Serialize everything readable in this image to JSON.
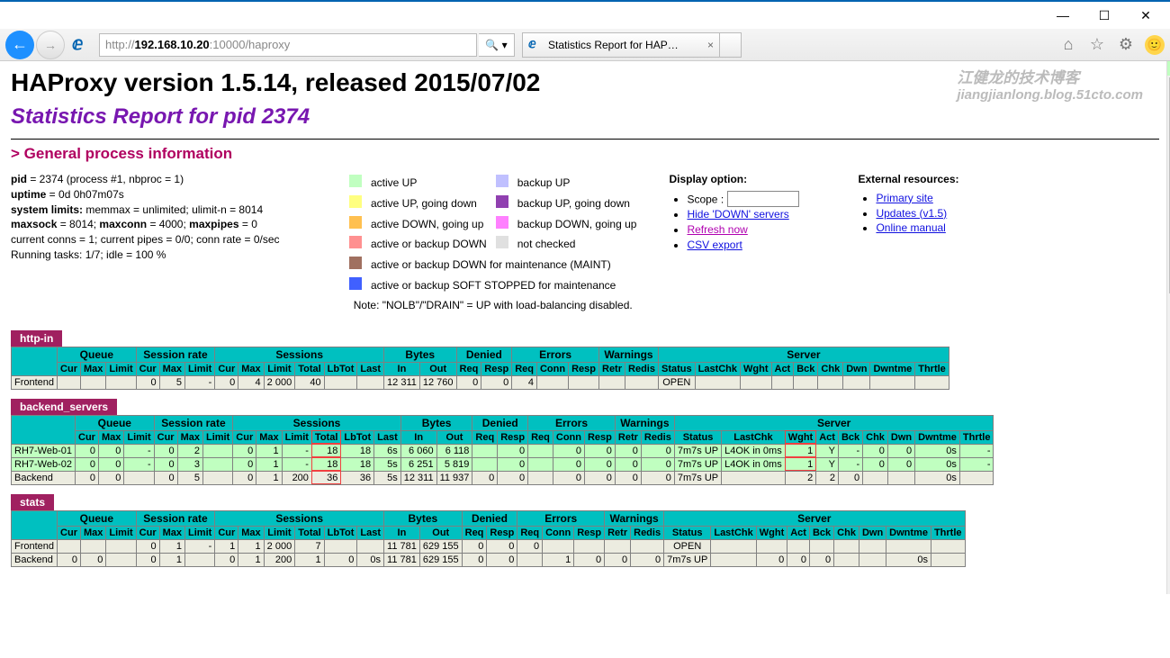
{
  "window": {
    "min": "—",
    "max": "☐",
    "close": "✕"
  },
  "browser": {
    "url_prefix": "http://",
    "url_host": "192.168.10.20",
    "url_port": ":10000",
    "url_path": "/haproxy",
    "tab_title": "Statistics Report for HAP…"
  },
  "watermark": {
    "line1": "江健龙的技术博客",
    "line2": "jiangjianlong.blog.51cto.com"
  },
  "header": {
    "title": "HAProxy version 1.5.14, released 2015/07/02",
    "subtitle": "Statistics Report for pid 2374",
    "section": "> General process information"
  },
  "process": {
    "l1a": "pid",
    "l1b": " = 2374 (process #1, nbproc = 1)",
    "l2a": "uptime",
    "l2b": " = 0d 0h07m07s",
    "l3a": "system limits:",
    "l3b": " memmax = unlimited; ulimit-n = 8014",
    "l4a": "maxsock",
    "l4b": " = 8014; ",
    "l4c": "maxconn",
    "l4d": " = 4000; ",
    "l4e": "maxpipes",
    "l4f": " = 0",
    "l5": "current conns = 1; current pipes = 0/0; conn rate = 0/sec",
    "l6": "Running tasks: 1/7; idle = 100 %"
  },
  "legend": {
    "aup": "active UP",
    "aupgd": "active UP, going down",
    "adgu": "active DOWN, going up",
    "adown": "active or backup DOWN",
    "maint": "active or backup DOWN for maintenance (MAINT)",
    "soft": "active or backup SOFT STOPPED for maintenance",
    "bup": "backup UP",
    "bupgd": "backup UP, going down",
    "bdgu": "backup DOWN, going up",
    "nc": "not checked",
    "note": "Note: \"NOLB\"/\"DRAIN\" = UP with load-balancing disabled."
  },
  "display": {
    "hdr": "Display option:",
    "scope": "Scope :",
    "hide": "Hide 'DOWN' servers",
    "refresh": "Refresh now",
    "csv": "CSV export"
  },
  "ext": {
    "hdr": "External resources:",
    "primary": "Primary site",
    "updates": "Updates (v1.5)",
    "manual": "Online manual"
  },
  "colgroups": {
    "queue": "Queue",
    "srate": "Session rate",
    "sessions": "Sessions",
    "bytes": "Bytes",
    "denied": "Denied",
    "errors": "Errors",
    "warnings": "Warnings",
    "server": "Server"
  },
  "cols": {
    "cur": "Cur",
    "max": "Max",
    "limit": "Limit",
    "total": "Total",
    "lbtot": "LbTot",
    "last": "Last",
    "in": "In",
    "out": "Out",
    "req": "Req",
    "resp": "Resp",
    "conn": "Conn",
    "retr": "Retr",
    "redis": "Redis",
    "status": "Status",
    "lastchk": "LastChk",
    "wght": "Wght",
    "act": "Act",
    "bck": "Bck",
    "chk": "Chk",
    "dwn": "Dwn",
    "dwntme": "Dwntme",
    "thrtle": "Thrtle"
  },
  "tables": {
    "http_in": {
      "name": "http-in",
      "frontend": {
        "name": "Frontend",
        "sr_cur": "0",
        "sr_max": "5",
        "sr_lim": "-",
        "s_cur": "0",
        "s_max": "4",
        "s_lim": "2 000",
        "s_tot": "40",
        "b_in": "12 311",
        "b_out": "12 760",
        "d_req": "0",
        "d_resp": "0",
        "e_req": "4",
        "status": "OPEN"
      }
    },
    "backend_servers": {
      "name": "backend_servers",
      "rows": [
        {
          "name": "RH7-Web-01",
          "q_cur": "0",
          "q_max": "0",
          "q_lim": "-",
          "sr_cur": "0",
          "sr_max": "2",
          "s_cur": "0",
          "s_max": "1",
          "s_lim": "-",
          "s_tot": "18",
          "lbtot": "18",
          "last": "6s",
          "b_in": "6 060",
          "b_out": "6 118",
          "d_req": "",
          "d_resp": "0",
          "e_req": "",
          "e_conn": "0",
          "e_resp": "0",
          "w_retr": "0",
          "w_redis": "0",
          "status": "7m7s UP",
          "lastchk": "L4OK in 0ms",
          "wght": "1",
          "act": "Y",
          "bck": "-",
          "chk": "0",
          "dwn": "0",
          "dwntme": "0s",
          "thrtle": "-"
        },
        {
          "name": "RH7-Web-02",
          "q_cur": "0",
          "q_max": "0",
          "q_lim": "-",
          "sr_cur": "0",
          "sr_max": "3",
          "s_cur": "0",
          "s_max": "1",
          "s_lim": "-",
          "s_tot": "18",
          "lbtot": "18",
          "last": "5s",
          "b_in": "6 251",
          "b_out": "5 819",
          "d_req": "",
          "d_resp": "0",
          "e_req": "",
          "e_conn": "0",
          "e_resp": "0",
          "w_retr": "0",
          "w_redis": "0",
          "status": "7m7s UP",
          "lastchk": "L4OK in 0ms",
          "wght": "1",
          "act": "Y",
          "bck": "-",
          "chk": "0",
          "dwn": "0",
          "dwntme": "0s",
          "thrtle": "-"
        }
      ],
      "backend": {
        "name": "Backend",
        "q_cur": "0",
        "q_max": "0",
        "sr_cur": "0",
        "sr_max": "5",
        "s_cur": "0",
        "s_max": "1",
        "s_lim": "200",
        "s_tot": "36",
        "lbtot": "36",
        "last": "5s",
        "b_in": "12 311",
        "b_out": "11 937",
        "d_req": "0",
        "d_resp": "0",
        "e_req": "",
        "e_conn": "0",
        "e_resp": "0",
        "w_retr": "0",
        "w_redis": "0",
        "status": "7m7s UP",
        "wght": "2",
        "act": "2",
        "bck": "0",
        "dwntme": "0s"
      }
    },
    "stats": {
      "name": "stats",
      "frontend": {
        "name": "Frontend",
        "sr_cur": "0",
        "sr_max": "1",
        "sr_lim": "-",
        "s_cur": "1",
        "s_max": "1",
        "s_lim": "2 000",
        "s_tot": "7",
        "b_in": "11 781",
        "b_out": "629 155",
        "d_req": "0",
        "d_resp": "0",
        "e_req": "0",
        "status": "OPEN"
      },
      "backend": {
        "name": "Backend",
        "q_cur": "0",
        "q_max": "0",
        "sr_cur": "0",
        "sr_max": "1",
        "s_cur": "0",
        "s_max": "1",
        "s_lim": "200",
        "s_tot": "1",
        "lbtot": "0",
        "last": "0s",
        "b_in": "11 781",
        "b_out": "629 155",
        "d_req": "0",
        "d_resp": "0",
        "e_conn": "1",
        "e_resp": "0",
        "w_retr": "0",
        "w_redis": "0",
        "status": "7m7s UP",
        "wght": "0",
        "act": "0",
        "bck": "0",
        "dwntme": "0s"
      }
    }
  }
}
